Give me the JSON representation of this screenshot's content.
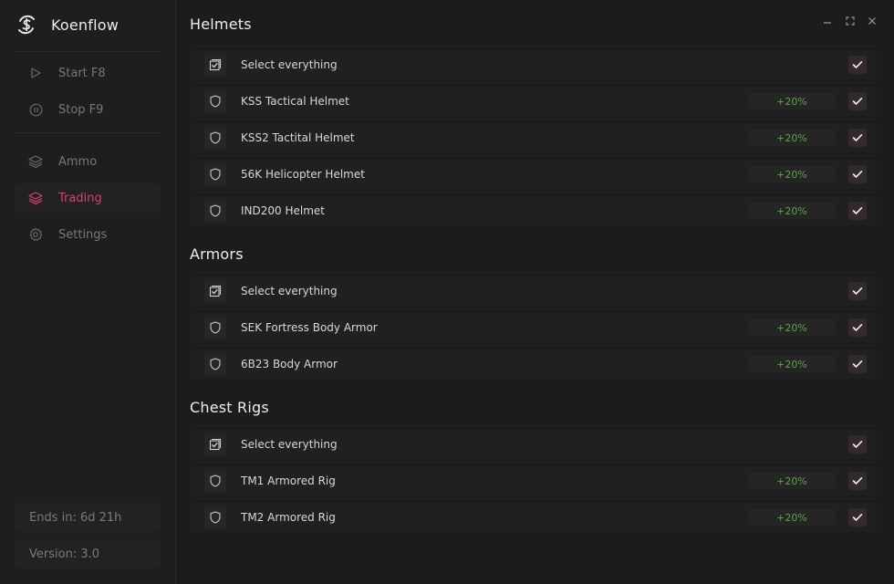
{
  "app": {
    "title": "Koenflow",
    "logo_icon": "dollar-swirl-icon"
  },
  "sidebar": {
    "items": [
      {
        "label": "Start F8",
        "icon": "play-icon"
      },
      {
        "label": "Stop F9",
        "icon": "pause-icon"
      },
      {
        "label": "Ammo",
        "icon": "layers-icon"
      },
      {
        "label": "Trading",
        "icon": "layers-icon",
        "active": true
      },
      {
        "label": "Settings",
        "icon": "gear-icon"
      }
    ],
    "ends_in": "Ends in: 6d 21h",
    "version": "Version: 3.0"
  },
  "window_controls": [
    "minimize-icon",
    "maximize-icon",
    "close-icon"
  ],
  "colors": {
    "accent": "#d6416f",
    "bonus": "#5aa840",
    "check_bg": "#322a2d"
  },
  "sections": [
    {
      "title": "Helmets",
      "select_all": "Select everything",
      "items": [
        {
          "label": "KSS Tactical Helmet",
          "bonus": "+20%"
        },
        {
          "label": "KSS2 Tactital Helmet",
          "bonus": "+20%"
        },
        {
          "label": "56K Helicopter Helmet",
          "bonus": "+20%"
        },
        {
          "label": "IND200 Helmet",
          "bonus": "+20%"
        }
      ]
    },
    {
      "title": "Armors",
      "select_all": "Select everything",
      "items": [
        {
          "label": "SEK Fortress Body Armor",
          "bonus": "+20%"
        },
        {
          "label": "6B23 Body Armor",
          "bonus": "+20%"
        }
      ]
    },
    {
      "title": "Chest Rigs",
      "select_all": "Select everything",
      "items": [
        {
          "label": "TM1 Armored Rig",
          "bonus": "+20%"
        },
        {
          "label": "TM2 Armored Rig",
          "bonus": "+20%"
        }
      ]
    }
  ]
}
